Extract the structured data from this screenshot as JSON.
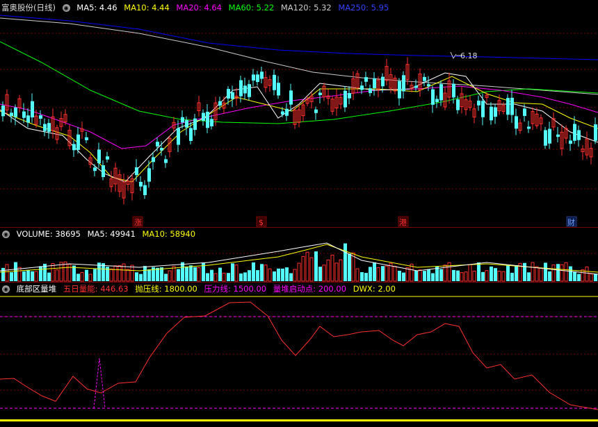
{
  "header": {
    "stock_name": "富奥股份(日线)",
    "ma_labels": [
      {
        "label": "MA5: 4.46",
        "color": "#ffffff"
      },
      {
        "label": "MA10: 4.44",
        "color": "#ffff00"
      },
      {
        "label": "MA20: 4.64",
        "color": "#ff00ff"
      },
      {
        "label": "MA60: 5.22",
        "color": "#00ff00"
      },
      {
        "label": "MA120: 5.32",
        "color": "#cccccc"
      },
      {
        "label": "MA250: 5.95",
        "color": "#0000ff"
      }
    ]
  },
  "price_panel": {
    "high_marker": "6.18",
    "event_markers": [
      {
        "label": "涨",
        "color": "#ff3030"
      },
      {
        "label": "$",
        "color": "#ff3030"
      },
      {
        "label": "港",
        "color": "#ff3030"
      },
      {
        "label": "财",
        "color": "#6fa0ff"
      }
    ]
  },
  "volume_panel": {
    "title": "VOLUME: 38695",
    "ma5": "MA5: 49941",
    "ma10": "MA10: 58940"
  },
  "indicator_panel": {
    "title": "底部区量堆",
    "items": [
      {
        "label": "五日量能: 446.63",
        "color": "#ff3030"
      },
      {
        "label": "抛压线: 1800.00",
        "color": "#ffff00"
      },
      {
        "label": "压力线: 1500.00",
        "color": "#ff00ff"
      },
      {
        "label": "量堆启动点: 200.00",
        "color": "#ff00ff"
      },
      {
        "label": "DWX: 2.00",
        "color": "#ffff00"
      }
    ]
  },
  "colors": {
    "up": "#ff3030",
    "down": "#54ffff",
    "grid": "#7a0000",
    "ma5": "#ffffff",
    "ma10": "#ffff00",
    "ma20": "#ff00ff",
    "ma60": "#00ff00",
    "ma120": "#cccccc",
    "ma250": "#0000ff"
  }
}
